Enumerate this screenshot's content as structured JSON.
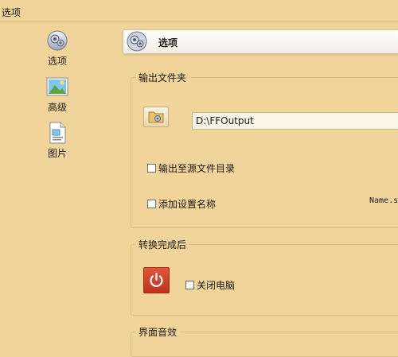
{
  "window": {
    "title": "选项"
  },
  "sidebar": {
    "items": [
      {
        "label": "选项",
        "icon": "gear-options-icon"
      },
      {
        "label": "高级",
        "icon": "landscape-picture-icon"
      },
      {
        "label": "图片",
        "icon": "document-picture-icon"
      }
    ]
  },
  "header": {
    "title": "选项",
    "icon": "gear-options-icon"
  },
  "output_folder": {
    "legend": "输出文件夹",
    "path": "D:\\FFOutput",
    "folder_icon": "folder-icon",
    "to_source_label": "输出至源文件目录",
    "add_setting_name_label": "添加设置名称",
    "name_preview": "Name.s"
  },
  "after_convert": {
    "legend": "转换完成后",
    "power_icon": "power-icon",
    "shutdown_label": "关闭电脑"
  },
  "ui_sound": {
    "legend": "界面音效"
  },
  "colors": {
    "background": "#f1d49a",
    "power_button": "#d2422a"
  }
}
